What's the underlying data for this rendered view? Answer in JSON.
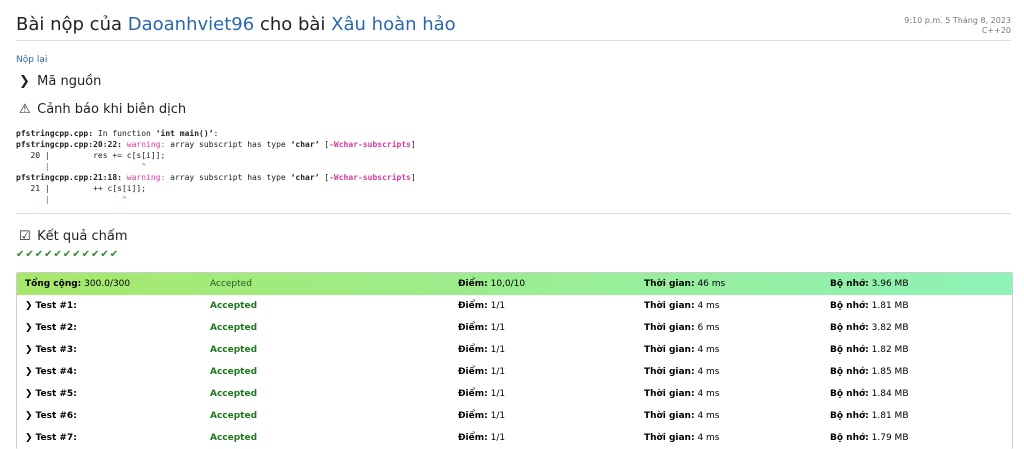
{
  "header": {
    "prefix": "Bài nộp của",
    "user": "Daoanhviet96",
    "middle": "cho bài",
    "problem": "Xâu hoàn hảo",
    "datetime": "9:10 p.m. 5 Tháng 8, 2023",
    "language": "C++20"
  },
  "resubmit_label": "Nộp lại",
  "source_section": {
    "icon": "chevron-right-icon",
    "label": "Mã nguồn"
  },
  "warning_section": {
    "icon": "warning-icon",
    "label": "Cảnh báo khi biên dịch"
  },
  "compile": {
    "file": "pfstringcpp.cpp:",
    "in_function": " In function ",
    "func": "‘int main()’",
    "colon": ":",
    "w1_loc": "pfstringcpp.cpp:20:22:",
    "w2_loc": "pfstringcpp.cpp:21:18:",
    "warning": " warning:",
    "msg_a": " array subscript has type ",
    "char_type": "‘char’",
    "flag_open": " [",
    "flag": "-Wchar-subscripts",
    "flag_close": "]",
    "line1_no": "   20 |",
    "line1_code": "         res += c[s[i]];",
    "caret1_pad": "      |",
    "caret1": "                   ^",
    "line2_no": "   21 |",
    "line2_code": "         ++ c[s[i]];",
    "caret2_pad": "      |",
    "caret2": "               ^"
  },
  "result_section": {
    "icon": "checkbox-icon",
    "label": "Kết quả chấm"
  },
  "status_icons": "✔✔✔✔✔✔✔✔✔✔✔",
  "labels": {
    "score": "Điểm:",
    "time": "Thời gian:",
    "memory": "Bộ nhớ:"
  },
  "total": {
    "label": "Tổng cộng:",
    "value": "300.0/300",
    "status": "Accepted",
    "score": "10,0/10",
    "time": "46 ms",
    "memory": "3.96 MB"
  },
  "tests": [
    {
      "name": "Test #1:",
      "status": "Accepted",
      "score": "1/1",
      "time": "4 ms",
      "memory": "1.81 MB"
    },
    {
      "name": "Test #2:",
      "status": "Accepted",
      "score": "1/1",
      "time": "6 ms",
      "memory": "3.82 MB"
    },
    {
      "name": "Test #3:",
      "status": "Accepted",
      "score": "1/1",
      "time": "4 ms",
      "memory": "1.82 MB"
    },
    {
      "name": "Test #4:",
      "status": "Accepted",
      "score": "1/1",
      "time": "4 ms",
      "memory": "1.85 MB"
    },
    {
      "name": "Test #5:",
      "status": "Accepted",
      "score": "1/1",
      "time": "4 ms",
      "memory": "1.84 MB"
    },
    {
      "name": "Test #6:",
      "status": "Accepted",
      "score": "1/1",
      "time": "4 ms",
      "memory": "1.81 MB"
    },
    {
      "name": "Test #7:",
      "status": "Accepted",
      "score": "1/1",
      "time": "4 ms",
      "memory": "1.79 MB"
    }
  ]
}
